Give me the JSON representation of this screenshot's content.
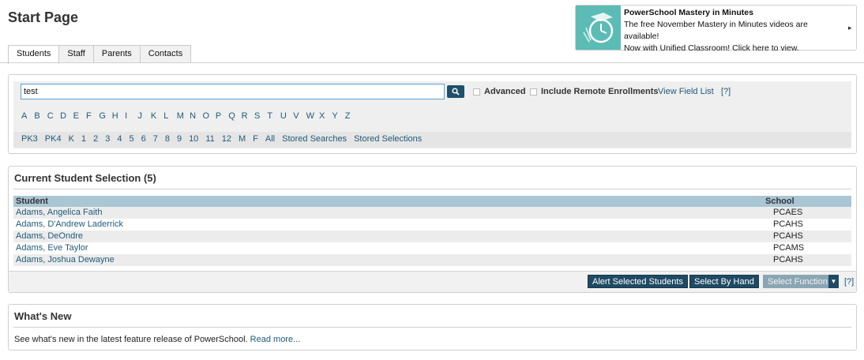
{
  "page": {
    "title": "Start Page"
  },
  "tabs": [
    "Students",
    "Staff",
    "Parents",
    "Contacts"
  ],
  "promo": {
    "title": "PowerSchool Mastery in Minutes",
    "line1": "The free November Mastery in Minutes videos are available!",
    "line2": "Now with Unified Classroom! Click here to view."
  },
  "search": {
    "value": "test",
    "advanced_label": "Advanced",
    "remote_label": "Include Remote Enrollments",
    "view_field_list": "View Field List",
    "help": "[?]"
  },
  "alphabet": [
    "A",
    "B",
    "C",
    "D",
    "E",
    "F",
    "G",
    "H",
    "I",
    "J",
    "K",
    "L",
    "M",
    "N",
    "O",
    "P",
    "Q",
    "R",
    "S",
    "T",
    "U",
    "V",
    "W",
    "X",
    "Y",
    "Z"
  ],
  "grades": [
    "PK3",
    "PK4",
    "K",
    "1",
    "2",
    "3",
    "4",
    "5",
    "6",
    "7",
    "8",
    "9",
    "10",
    "11",
    "12",
    "M",
    "F",
    "All",
    "Stored Searches",
    "Stored Selections"
  ],
  "selection": {
    "title": "Current Student Selection (5)",
    "col_student": "Student",
    "col_school": "School",
    "rows": [
      {
        "student": "Adams, Angelica Faith",
        "school": "PCAES"
      },
      {
        "student": "Adams, D'Andrew Laderrick",
        "school": "PCAHS"
      },
      {
        "student": "Adams, DeOndre",
        "school": "PCAHS"
      },
      {
        "student": "Adams, Eve Taylor",
        "school": "PCAMS"
      },
      {
        "student": "Adams, Joshua Dewayne",
        "school": "PCAHS"
      }
    ],
    "btn_alert": "Alert Selected Students",
    "btn_hand": "Select By Hand",
    "btn_function": "Select Function",
    "help": "[?]"
  },
  "news": {
    "title": "What's New",
    "body": "See what's new in the latest feature release of PowerSchool.",
    "link": "Read more..."
  }
}
